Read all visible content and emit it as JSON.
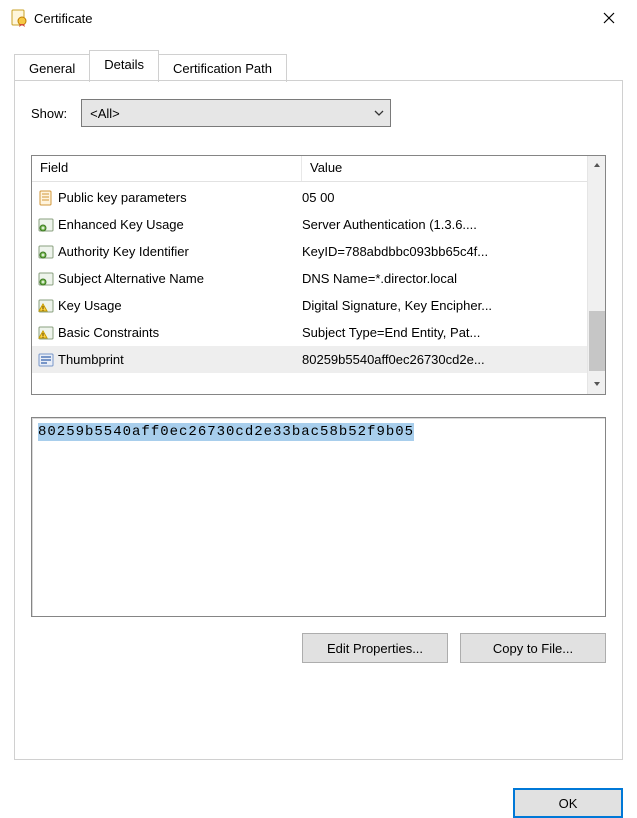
{
  "window": {
    "title": "Certificate"
  },
  "tabs": {
    "general": "General",
    "details": "Details",
    "certpath": "Certification Path"
  },
  "show": {
    "label": "Show:",
    "value": "<All>"
  },
  "columns": {
    "field": "Field",
    "value": "Value"
  },
  "rows": [
    {
      "icon": "doc",
      "field": "Public key parameters",
      "value": "05 00"
    },
    {
      "icon": "ext",
      "field": "Enhanced Key Usage",
      "value": "Server Authentication (1.3.6...."
    },
    {
      "icon": "ext",
      "field": "Authority Key Identifier",
      "value": "KeyID=788abdbbc093bb65c4f..."
    },
    {
      "icon": "ext",
      "field": "Subject Alternative Name",
      "value": "DNS Name=*.director.local"
    },
    {
      "icon": "warn",
      "field": "Key Usage",
      "value": "Digital Signature, Key Encipher..."
    },
    {
      "icon": "warn",
      "field": "Basic Constraints",
      "value": "Subject Type=End Entity, Pat..."
    },
    {
      "icon": "thumb",
      "field": "Thumbprint",
      "value": "80259b5540aff0ec26730cd2e..."
    }
  ],
  "detail_value": "80259b5540aff0ec26730cd2e33bac58b52f9b05",
  "buttons": {
    "edit": "Edit Properties...",
    "copy": "Copy to File...",
    "ok": "OK"
  }
}
